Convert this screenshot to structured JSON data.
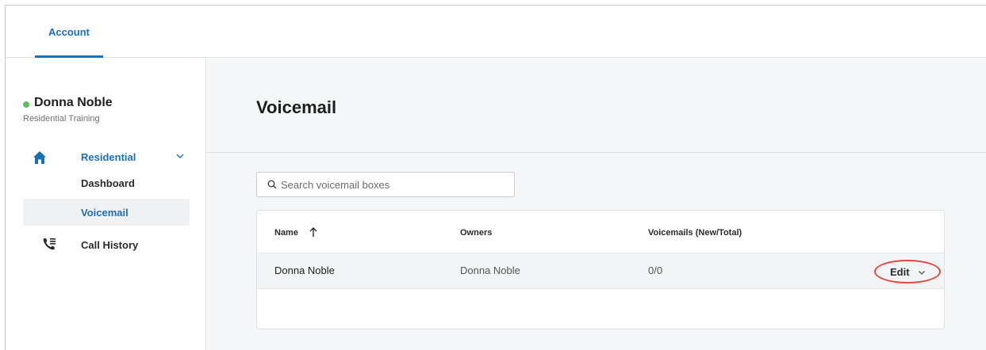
{
  "topbar": {
    "tab_account": "Account"
  },
  "user": {
    "name": "Donna Noble",
    "subtitle": "Residential Training",
    "status_color": "#5cc15a"
  },
  "nav": {
    "group_label": "Residential",
    "items": [
      {
        "label": "Dashboard"
      },
      {
        "label": "Voicemail"
      }
    ],
    "call_history": "Call History"
  },
  "page": {
    "title": "Voicemail"
  },
  "search": {
    "placeholder": "Search voicemail boxes",
    "value": ""
  },
  "table": {
    "headers": {
      "name": "Name",
      "owners": "Owners",
      "voicemails": "Voicemails (New/Total)"
    },
    "sort": {
      "column": "name",
      "direction": "ascending"
    },
    "rows": [
      {
        "name": "Donna Noble",
        "owners": "Donna Noble",
        "voicemails": "0/0",
        "action": "Edit"
      }
    ]
  },
  "colors": {
    "accent": "#1a6fb5",
    "highlight_circle": "#e0483c"
  }
}
